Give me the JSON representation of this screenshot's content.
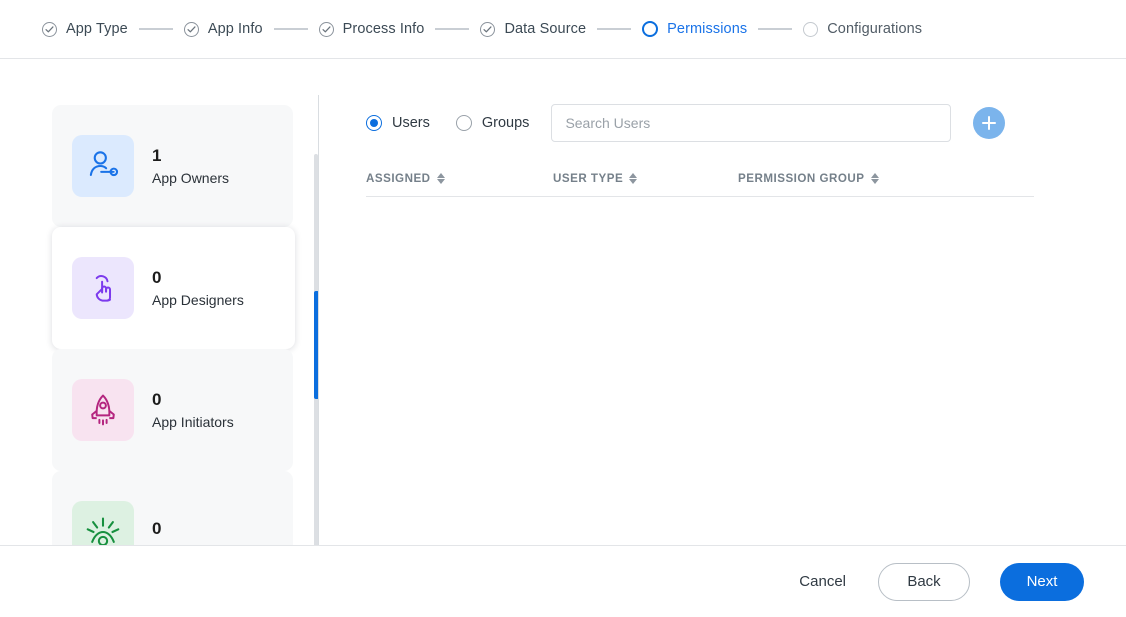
{
  "stepper": {
    "steps": [
      {
        "label": "App Type",
        "state": "completed",
        "icon": "check-circle-icon"
      },
      {
        "label": "App Info",
        "state": "completed",
        "icon": "check-circle-icon"
      },
      {
        "label": "Process Info",
        "state": "completed",
        "icon": "check-circle-icon"
      },
      {
        "label": "Data Source",
        "state": "completed",
        "icon": "check-circle-icon"
      },
      {
        "label": "Permissions",
        "state": "active",
        "icon": "ring-circle-icon"
      },
      {
        "label": "Configurations",
        "state": "pending",
        "icon": "empty-circle-icon"
      }
    ]
  },
  "colors": {
    "accent": "#0b6ede",
    "active_step_text": "#1a73e8",
    "scrollbar_thumb": "#0b6ede",
    "add_button": "#7bb4ec",
    "owners_icon": "#1a73e8",
    "owners_tile": "#dbeafe",
    "designers_icon": "#7c3aed",
    "designers_tile": "#ece6fd",
    "initiators_icon": "#b4257f",
    "initiators_tile": "#f8e3f0",
    "viewers_icon": "#17903f",
    "viewers_tile": "#ddf1e2"
  },
  "roles": [
    {
      "count": "1",
      "label": "App Owners",
      "icon": "user-key-icon",
      "selected": false
    },
    {
      "count": "0",
      "label": "App Designers",
      "icon": "tap-hand-icon",
      "selected": true
    },
    {
      "count": "0",
      "label": "App Initiators",
      "icon": "rocket-icon",
      "selected": false
    },
    {
      "count": "0",
      "label": "",
      "icon": "eye-rays-icon",
      "selected": false
    }
  ],
  "toolbar": {
    "radio_options": [
      {
        "label": "Users",
        "checked": true
      },
      {
        "label": "Groups",
        "checked": false
      }
    ],
    "search": {
      "value": "",
      "placeholder": "Search Users"
    },
    "add_button_icon": "plus-icon"
  },
  "table": {
    "columns": [
      {
        "label": "ASSIGNED",
        "sort_icon": "sort-arrows-icon"
      },
      {
        "label": "USER TYPE",
        "sort_icon": "sort-arrows-icon"
      },
      {
        "label": "PERMISSION GROUP",
        "sort_icon": "sort-arrows-icon"
      }
    ],
    "rows": []
  },
  "footer": {
    "cancel_label": "Cancel",
    "back_label": "Back",
    "next_label": "Next"
  }
}
